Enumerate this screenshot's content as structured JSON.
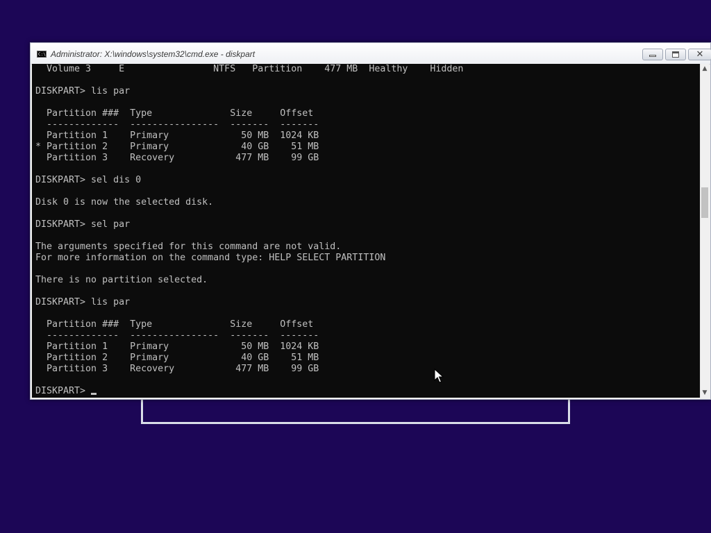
{
  "window": {
    "title": "Administrator: X:\\windows\\system32\\cmd.exe - diskpart",
    "icon_name": "cmd-icon",
    "icon_label": "C:\\"
  },
  "controls": {
    "minimize_icon": "minimize-icon",
    "maximize_icon": "maximize-icon",
    "close_glyph": "✕"
  },
  "console": {
    "lines": [
      "  Volume 3     E                NTFS   Partition    477 MB  Healthy    Hidden",
      "",
      "DISKPART> lis par",
      "",
      "  Partition ###  Type              Size     Offset",
      "  -------------  ----------------  -------  -------",
      "  Partition 1    Primary             50 MB  1024 KB",
      "* Partition 2    Primary             40 GB    51 MB",
      "  Partition 3    Recovery           477 MB    99 GB",
      "",
      "DISKPART> sel dis 0",
      "",
      "Disk 0 is now the selected disk.",
      "",
      "DISKPART> sel par",
      "",
      "The arguments specified for this command are not valid.",
      "For more information on the command type: HELP SELECT PARTITION",
      "",
      "There is no partition selected.",
      "",
      "DISKPART> lis par",
      "",
      "  Partition ###  Type              Size     Offset",
      "  -------------  ----------------  -------  -------",
      "  Partition 1    Primary             50 MB  1024 KB",
      "  Partition 2    Primary             40 GB    51 MB",
      "  Partition 3    Recovery           477 MB    99 GB",
      ""
    ],
    "prompt": "DISKPART> "
  },
  "scrollbar": {
    "up_arrow": "▲",
    "down_arrow": "▼"
  },
  "colors": {
    "desktop_background": "#1c0656",
    "console_background": "#0c0c0c",
    "console_text": "#c0c0c0"
  }
}
